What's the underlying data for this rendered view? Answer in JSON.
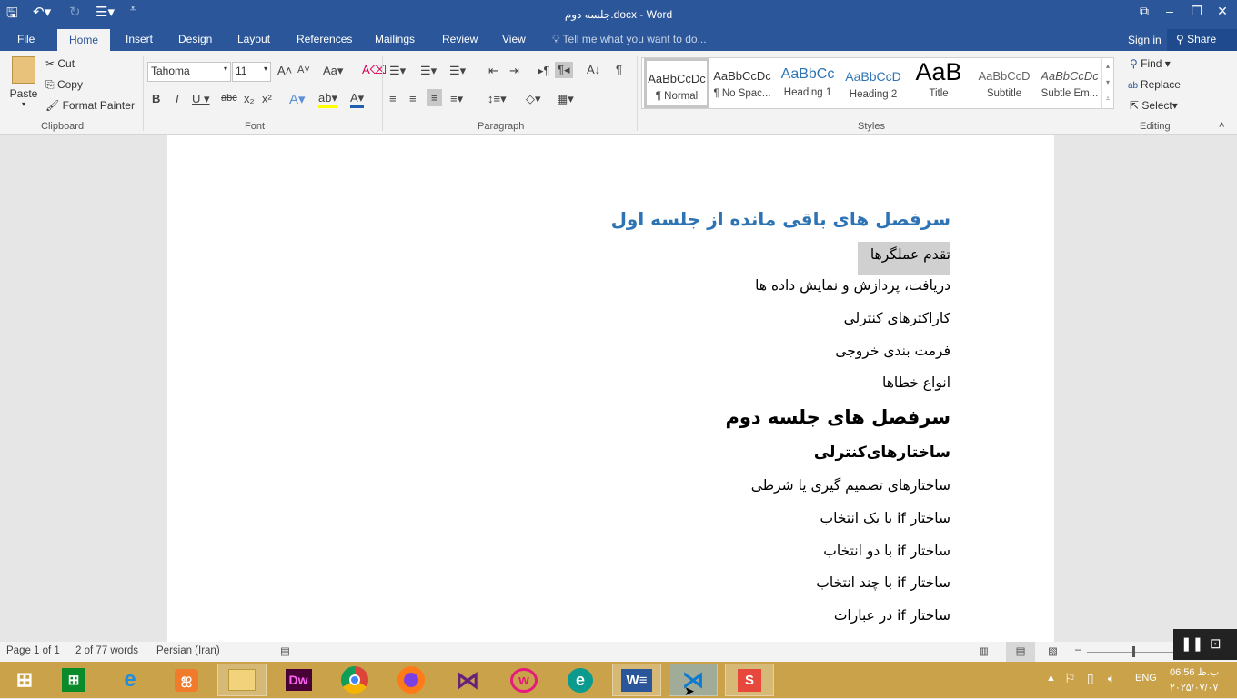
{
  "window": {
    "title": "جلسه دوم.docx - Word"
  },
  "tabs": [
    "File",
    "Home",
    "Insert",
    "Design",
    "Layout",
    "References",
    "Mailings",
    "Review",
    "View"
  ],
  "tell_me": "Tell me what you want to do...",
  "sign_in": "Sign in",
  "share": "Share",
  "clipboard": {
    "paste": "Paste",
    "cut": "Cut",
    "copy": "Copy",
    "format_painter": "Format Painter",
    "label": "Clipboard"
  },
  "font": {
    "name": "Tahoma",
    "size": "11",
    "label": "Font"
  },
  "paragraph": {
    "label": "Paragraph"
  },
  "styles": {
    "label": "Styles",
    "items": [
      {
        "preview": "AaBbCcDc",
        "name": "¶ Normal"
      },
      {
        "preview": "AaBbCcDc",
        "name": "¶ No Spac..."
      },
      {
        "preview": "AaBbCc",
        "name": "Heading 1"
      },
      {
        "preview": "AaBbCcD",
        "name": "Heading 2"
      },
      {
        "preview": "AaB",
        "name": "Title"
      },
      {
        "preview": "AaBbCcD",
        "name": "Subtitle"
      },
      {
        "preview": "AaBbCcDc",
        "name": "Subtle Em..."
      }
    ]
  },
  "editing": {
    "find": "Find",
    "replace": "Replace",
    "select": "Select",
    "label": "Editing"
  },
  "document": {
    "lines": [
      "سرفصل های باقی مانده از جلسه اول",
      "تقدم عملگرها",
      "دریافت، پردازش و نمایش داده ها",
      "کاراکترهای کنترلی",
      "فرمت بندی خروجی",
      "انواع خطاها",
      "سرفصل های جلسه دوم",
      "ساختارهای‌کنترلی",
      "ساختارهای تصمیم گیری یا شرطی",
      "ساختار if با یک انتخاب",
      "ساختار if با دو انتخاب",
      "ساختار if با چند انتخاب",
      "ساختار if در عبارات"
    ],
    "heading_color": "#2e74b5"
  },
  "status": {
    "page": "Page 1 of 1",
    "words": "2 of 77 words",
    "language": "Persian (Iran)"
  },
  "taskbar": {
    "apps": [
      "store",
      "internet-explorer",
      "xampp",
      "file-explorer",
      "dreamweaver",
      "chrome",
      "firefox",
      "visual-studio",
      "wamp",
      "eset",
      "word",
      "vscode",
      "sublime"
    ],
    "lang": "ENG",
    "time": "06:56 ب.ظ",
    "date": "۲۰۲۵/۰۷/۰۷"
  }
}
